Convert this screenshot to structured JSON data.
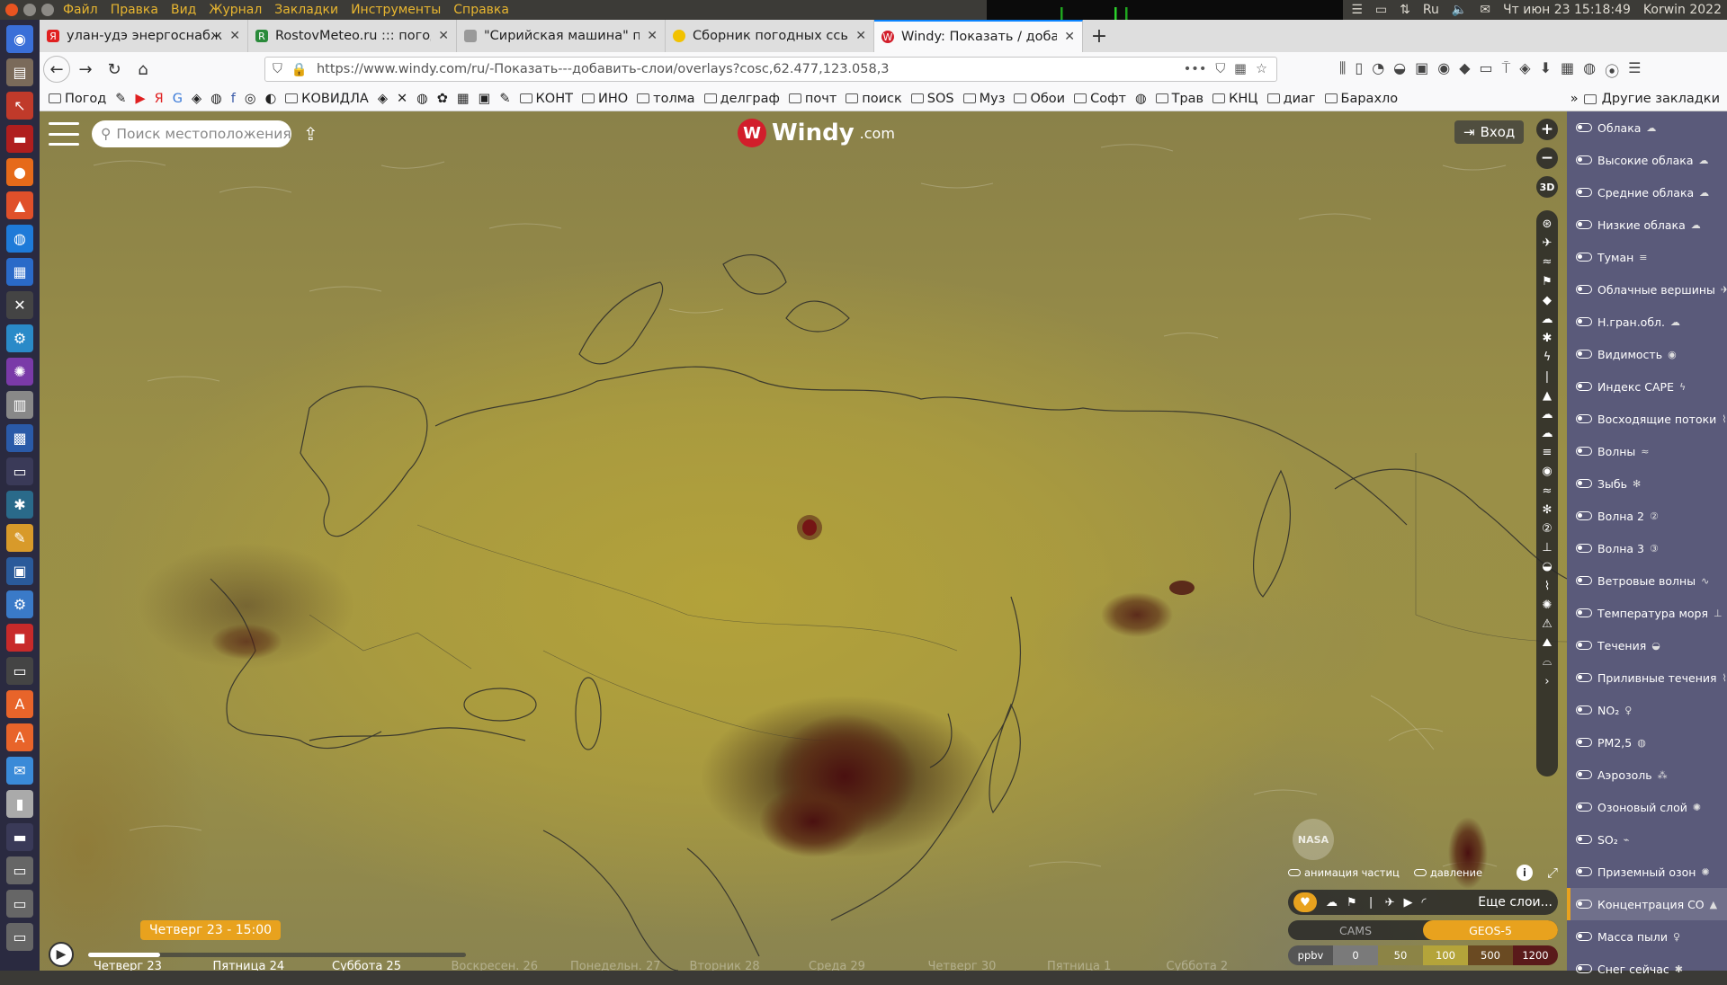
{
  "os": {
    "menus": [
      "Файл",
      "Правка",
      "Вид",
      "Журнал",
      "Закладки",
      "Инструменты",
      "Справка"
    ],
    "keyboard": "Ru",
    "datetime": "Чт июн 23 15:18:49",
    "user": "Korwin 2022"
  },
  "tabs": [
    {
      "label": "улан-удэ энергоснабже",
      "favicon": "yandex-icon",
      "color": "#e02020"
    },
    {
      "label": "RostovMeteo.ru ::: погод",
      "favicon": "rostovmeteo-icon",
      "color": "#2a8a3a"
    },
    {
      "label": "\"Сирийская машина\" пр",
      "favicon": "page-icon",
      "color": "#999999"
    },
    {
      "label": "Сборник погодных ссыл",
      "favicon": "sun-icon",
      "color": "#f2c200"
    },
    {
      "label": "Windy: Показать / доба",
      "favicon": "windy-icon",
      "color": "#d21e2b",
      "active": true
    }
  ],
  "url": "https://www.windy.com/ru/-Показать---добавить-слои/overlays?cosc,62.477,123.058,3",
  "bookmarks": [
    "Погод",
    "КОВИДЛА",
    "КОНТ",
    "ИНО",
    "толма",
    "делграф",
    "почт",
    "поиск",
    "SOS",
    "Муз",
    "Обои",
    "Софт",
    "Трав",
    "КНЦ",
    "диаг",
    "Барахло"
  ],
  "bookmarks_more": "Другие закладки",
  "windy": {
    "search_placeholder": "Поиск местоположения",
    "logo": "Windy",
    "logo_suffix": ".com",
    "login": "Вход",
    "nasa": "NASA",
    "toggle_particles": "анимация частиц",
    "toggle_pressure": "давление",
    "more_layers": "Еще слои...",
    "products": [
      "CAMS",
      "GEOS-5"
    ],
    "active_product": "GEOS-5",
    "legend_unit": "ppbv",
    "legend_values": [
      "0",
      "50",
      "100",
      "500",
      "1200"
    ],
    "legend_colors": [
      "#7a7a7a",
      "#8c8446",
      "#b4a43a",
      "#6a4a22",
      "#5a1a1a"
    ],
    "time_label": "Четверг 23 - 15:00",
    "timeline_progress": 0.19,
    "days": [
      {
        "label": "Четверг 23",
        "dim": false
      },
      {
        "label": "Пятница 24",
        "dim": false
      },
      {
        "label": "Суббота 25",
        "dim": false
      },
      {
        "label": "Воскресен. 26",
        "dim": true
      },
      {
        "label": "Понедельн. 27",
        "dim": true
      },
      {
        "label": "Вторник 28",
        "dim": true
      },
      {
        "label": "Среда 29",
        "dim": true
      },
      {
        "label": "Четверг 30",
        "dim": true
      },
      {
        "label": "Пятница 1",
        "dim": true
      },
      {
        "label": "Суббота 2",
        "dim": true
      }
    ]
  },
  "layers": [
    {
      "label": "Облака",
      "icon": "cloud-icon"
    },
    {
      "label": "Высокие облака",
      "icon": "cloud-icon"
    },
    {
      "label": "Средние облака",
      "icon": "cloud-icon"
    },
    {
      "label": "Низкие облака",
      "icon": "cloud-icon"
    },
    {
      "label": "Туман",
      "icon": "fog-icon"
    },
    {
      "label": "Облачные вершины",
      "icon": "plane-icon"
    },
    {
      "label": "Н.гран.обл.",
      "icon": "cloud-icon"
    },
    {
      "label": "Видимость",
      "icon": "eye-icon"
    },
    {
      "label": "Индекс CAPE",
      "icon": "storm-icon"
    },
    {
      "label": "Восходящие потоки",
      "icon": "glider-icon"
    },
    {
      "label": "Волны",
      "icon": "waves-icon"
    },
    {
      "label": "Зыбь",
      "icon": "swell-icon"
    },
    {
      "label": "Волна 2",
      "icon": "two-icon"
    },
    {
      "label": "Волна 3",
      "icon": "three-icon"
    },
    {
      "label": "Ветровые волны",
      "icon": "wave-icon"
    },
    {
      "label": "Температура моря",
      "icon": "thermometer-icon"
    },
    {
      "label": "Течения",
      "icon": "current-icon"
    },
    {
      "label": "Приливные течения",
      "icon": "tide-icon"
    },
    {
      "label": "NO₂",
      "icon": "no2-icon"
    },
    {
      "label": "PM2,5",
      "icon": "pm-icon"
    },
    {
      "label": "Аэрозоль",
      "icon": "aerosol-icon"
    },
    {
      "label": "Озоновый слой",
      "icon": "ozone-icon"
    },
    {
      "label": "SO₂",
      "icon": "so2-icon"
    },
    {
      "label": "Приземный озон",
      "icon": "ozone-icon"
    },
    {
      "label": "Концентрация CO",
      "icon": "co-icon",
      "selected": true
    },
    {
      "label": "Масса пыли",
      "icon": "dust-icon"
    },
    {
      "label": "Снег сейчас",
      "icon": "snow-icon"
    }
  ]
}
